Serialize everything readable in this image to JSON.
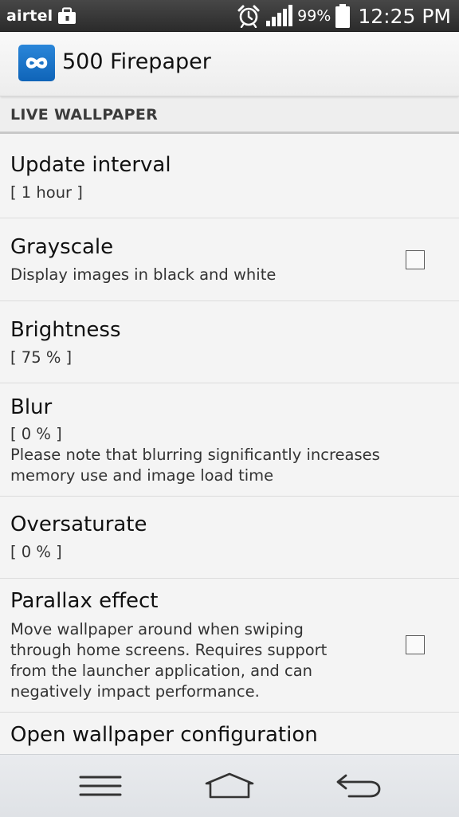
{
  "status_bar": {
    "carrier": "airtel",
    "battery_percent": "99%",
    "time": "12:25 PM",
    "icons": [
      "briefcase-icon",
      "alarm-icon",
      "signal-icon",
      "battery-icon"
    ]
  },
  "action_bar": {
    "title": "500 Firepaper",
    "icon": "infinity-icon",
    "icon_color": "#1a73c8"
  },
  "section": {
    "header": "LIVE WALLPAPER"
  },
  "preferences": {
    "update_interval": {
      "title": "Update interval",
      "summary": "[ 1 hour ]"
    },
    "grayscale": {
      "title": "Grayscale",
      "summary": "Display images in black and white",
      "checked": false
    },
    "brightness": {
      "title": "Brightness",
      "summary": "[ 75 % ]"
    },
    "blur": {
      "title": "Blur",
      "summary": "[ 0 % ]",
      "note_line1": "Please note that blurring significantly increases",
      "note_line2": "memory use and image load time"
    },
    "oversaturate": {
      "title": "Oversaturate",
      "summary": "[ 0 % ]"
    },
    "parallax": {
      "title": "Parallax effect",
      "summary_line1": "Move wallpaper around when swiping",
      "summary_line2": "through home screens. Requires support",
      "summary_line3": "from the launcher application, and can",
      "summary_line4": "negatively impact performance.",
      "checked": false
    },
    "open_config": {
      "title": "Open wallpaper configuration"
    }
  },
  "nav_bar": {
    "buttons": [
      "menu-icon",
      "home-icon",
      "back-icon"
    ]
  }
}
